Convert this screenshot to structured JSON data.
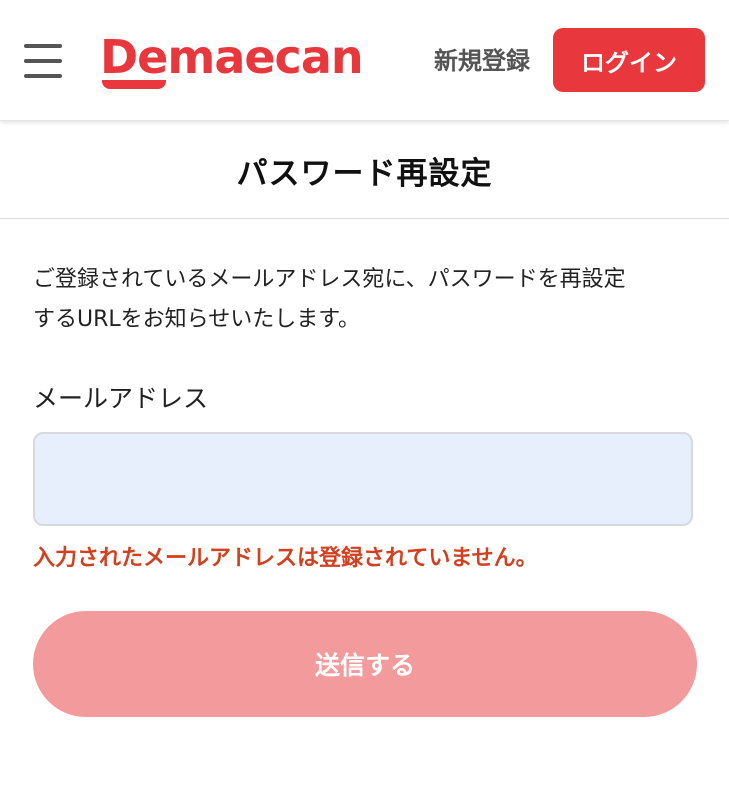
{
  "header": {
    "menu_icon": "hamburger-menu-icon",
    "logo_text": "Demaecan",
    "register_label": "新規登録",
    "login_label": "ログイン",
    "accent_color": "#e8383d"
  },
  "title": "パスワード再設定",
  "description": {
    "line1": "ご登録されているメールアドレス宛に、パスワードを再設定",
    "line2": "するURLをお知らせいたします。"
  },
  "email": {
    "label": "メールアドレス",
    "value": "",
    "placeholder": ""
  },
  "error_message": "入力されたメールアドレスは登録されていません。",
  "submit_label": "送信する",
  "colors": {
    "error": "#d3401f",
    "submit_disabled": "#f39b9c",
    "input_background": "#e8effc"
  }
}
